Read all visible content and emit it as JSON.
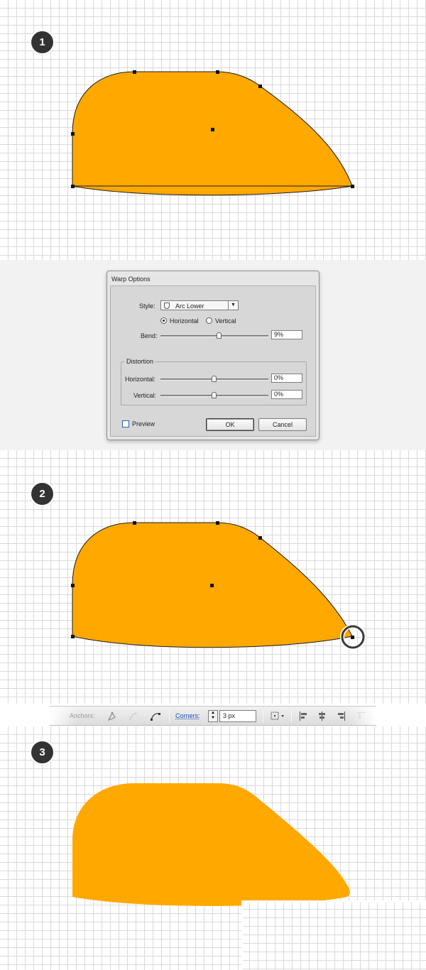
{
  "steps": [
    {
      "number": "1"
    },
    {
      "number": "2"
    },
    {
      "number": "3"
    }
  ],
  "colors": {
    "shape_fill": "#FFA800",
    "grid_line": "#D9D9D9",
    "badge": "#333333",
    "link_blue": "#1a4fb5"
  },
  "warp_dialog": {
    "title": "Warp Options",
    "style_label": "Style:",
    "style_value": "Arc Lower",
    "orientation_horizontal": "Horizontal",
    "orientation_vertical": "Vertical",
    "orientation_selected": "Horizontal",
    "bend_label": "Bend:",
    "bend_value": "9%",
    "bend_percent": 9,
    "distortion_title": "Distortion",
    "dist_horizontal_label": "Horizontal:",
    "dist_horizontal_value": "0%",
    "dist_vertical_label": "Vertical:",
    "dist_vertical_value": "0%",
    "preview_label": "Preview",
    "preview_checked": false,
    "ok_label": "OK",
    "cancel_label": "Cancel"
  },
  "control_bar": {
    "anchors_label": "Anchors:",
    "corners_label": "Corners:",
    "corners_value": "3 px",
    "icons": [
      "convert-anchor-icon",
      "handles-icon",
      "remove-anchor-icon",
      "transform-icon",
      "align-left-icon",
      "align-center-icon",
      "align-right-icon"
    ]
  }
}
